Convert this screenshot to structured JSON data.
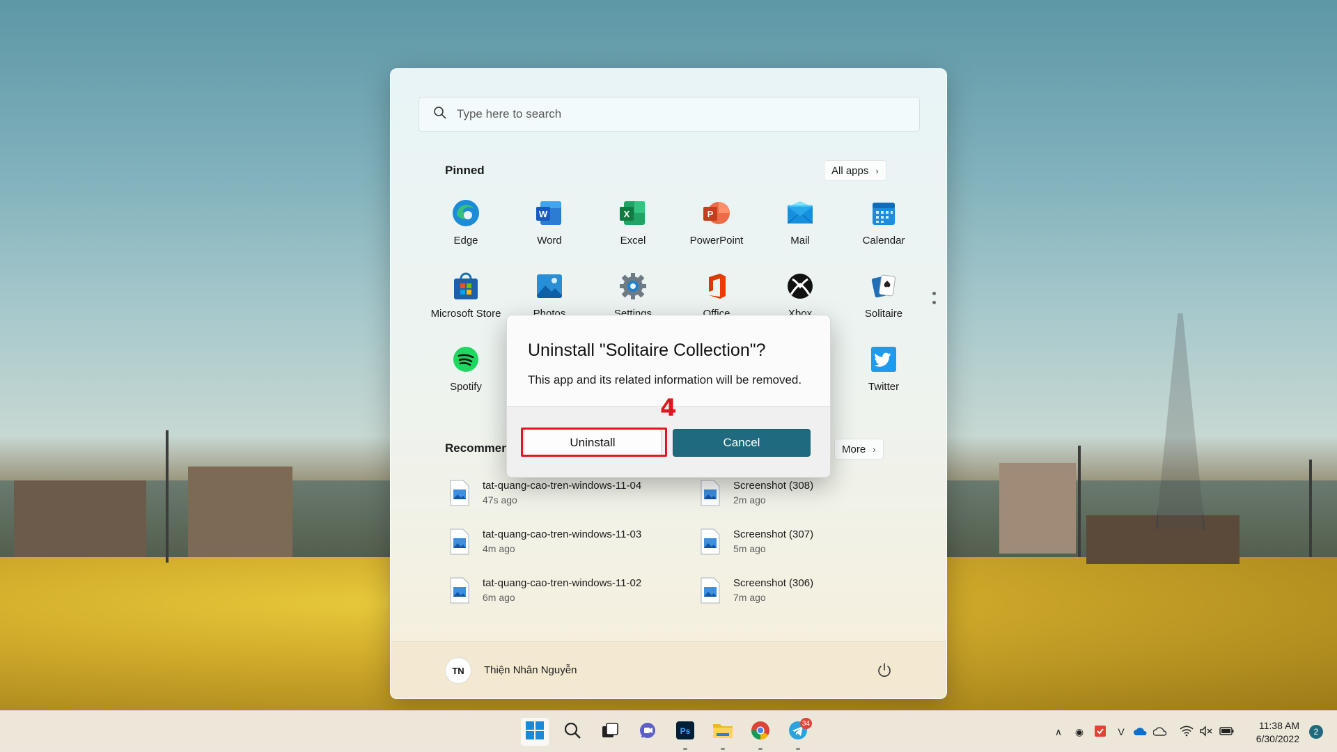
{
  "search": {
    "placeholder": "Type here to search"
  },
  "pinned": {
    "title": "Pinned",
    "all_apps_label": "All apps",
    "apps": [
      {
        "label": "Edge",
        "icon": "edge-icon"
      },
      {
        "label": "Word",
        "icon": "word-icon"
      },
      {
        "label": "Excel",
        "icon": "excel-icon"
      },
      {
        "label": "PowerPoint",
        "icon": "powerpoint-icon"
      },
      {
        "label": "Mail",
        "icon": "mail-icon"
      },
      {
        "label": "Calendar",
        "icon": "calendar-icon"
      },
      {
        "label": "Microsoft Store",
        "icon": "store-icon"
      },
      {
        "label": "Photos",
        "icon": "photos-icon"
      },
      {
        "label": "Settings",
        "icon": "settings-icon"
      },
      {
        "label": "Office",
        "icon": "office-icon"
      },
      {
        "label": "Xbox",
        "icon": "xbox-icon"
      },
      {
        "label": "Solitaire",
        "icon": "solitaire-icon"
      },
      {
        "label": "Spotify",
        "icon": "spotify-icon"
      },
      {
        "label": "Twitter",
        "icon": "twitter-icon"
      }
    ]
  },
  "recommended": {
    "title": "Recommended",
    "more_label": "More",
    "items": [
      {
        "name": "tat-quang-cao-tren-windows-11-04",
        "time": "47s ago"
      },
      {
        "name": "Screenshot (308)",
        "time": "2m ago"
      },
      {
        "name": "tat-quang-cao-tren-windows-11-03",
        "time": "4m ago"
      },
      {
        "name": "Screenshot (307)",
        "time": "5m ago"
      },
      {
        "name": "tat-quang-cao-tren-windows-11-02",
        "time": "6m ago"
      },
      {
        "name": "Screenshot (306)",
        "time": "7m ago"
      }
    ]
  },
  "user": {
    "name": "Thiện Nhân Nguyễn",
    "avatar_text": "TN"
  },
  "dialog": {
    "title": "Uninstall \"Solitaire Collection\"?",
    "message": "This app and its related information will be removed.",
    "uninstall_label": "Uninstall",
    "cancel_label": "Cancel",
    "step_number": "4"
  },
  "taskbar": {
    "telegram_badge": "34",
    "time": "11:38 AM",
    "date": "6/30/2022",
    "notification_count": "2"
  },
  "colors": {
    "accent": "#1f6a7c",
    "highlight": "#e3161f"
  }
}
